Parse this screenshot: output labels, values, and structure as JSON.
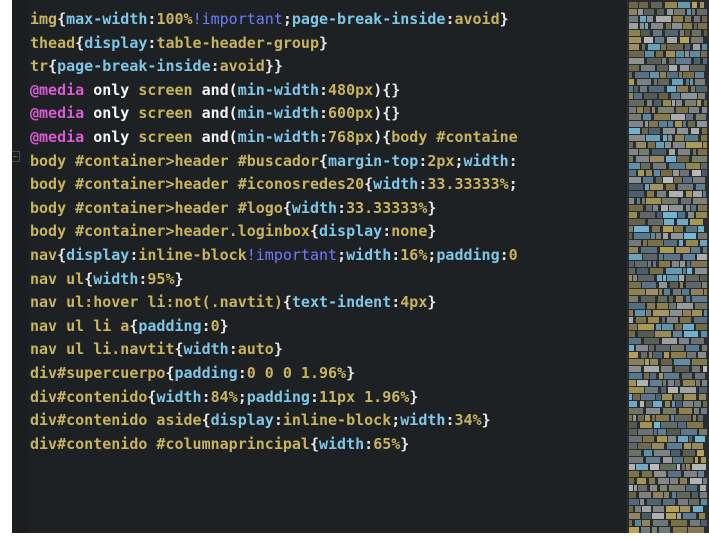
{
  "editor": {
    "fold_glyph": "−",
    "lines": [
      [
        {
          "t": "img",
          "c": "sel"
        },
        {
          "t": "{",
          "c": "punc"
        },
        {
          "t": "max-width",
          "c": "prop"
        },
        {
          "t": ":",
          "c": "punc"
        },
        {
          "t": "100%",
          "c": "val"
        },
        {
          "t": "!important",
          "c": "imp"
        },
        {
          "t": ";",
          "c": "punc"
        },
        {
          "t": "page-break-inside",
          "c": "prop"
        },
        {
          "t": ":",
          "c": "punc"
        },
        {
          "t": "avoid",
          "c": "val"
        },
        {
          "t": "}",
          "c": "punc"
        }
      ],
      [
        {
          "t": "thead",
          "c": "sel"
        },
        {
          "t": "{",
          "c": "punc"
        },
        {
          "t": "display",
          "c": "prop"
        },
        {
          "t": ":",
          "c": "punc"
        },
        {
          "t": "table-header-group",
          "c": "val"
        },
        {
          "t": "}",
          "c": "punc"
        }
      ],
      [
        {
          "t": "tr",
          "c": "sel"
        },
        {
          "t": "{",
          "c": "punc"
        },
        {
          "t": "page-break-inside",
          "c": "prop"
        },
        {
          "t": ":",
          "c": "punc"
        },
        {
          "t": "avoid",
          "c": "val"
        },
        {
          "t": "}}",
          "c": "punc"
        }
      ],
      [
        {
          "t": "@media",
          "c": "atrule"
        },
        {
          "t": " only ",
          "c": "kw"
        },
        {
          "t": "screen",
          "c": "val"
        },
        {
          "t": " and(",
          "c": "kw"
        },
        {
          "t": "min-width",
          "c": "prop"
        },
        {
          "t": ":",
          "c": "punc"
        },
        {
          "t": "480px",
          "c": "val"
        },
        {
          "t": "){}",
          "c": "punc"
        }
      ],
      [
        {
          "t": "@media",
          "c": "atrule"
        },
        {
          "t": " only ",
          "c": "kw"
        },
        {
          "t": "screen",
          "c": "val"
        },
        {
          "t": " and(",
          "c": "kw"
        },
        {
          "t": "min-width",
          "c": "prop"
        },
        {
          "t": ":",
          "c": "punc"
        },
        {
          "t": "600px",
          "c": "val"
        },
        {
          "t": "){}",
          "c": "punc"
        }
      ],
      [
        {
          "t": "@media",
          "c": "atrule"
        },
        {
          "t": " only ",
          "c": "kw"
        },
        {
          "t": "screen",
          "c": "val"
        },
        {
          "t": " and(",
          "c": "kw"
        },
        {
          "t": "min-width",
          "c": "prop"
        },
        {
          "t": ":",
          "c": "punc"
        },
        {
          "t": "768px",
          "c": "val"
        },
        {
          "t": "){",
          "c": "punc"
        },
        {
          "t": "body #containe",
          "c": "sel"
        }
      ],
      [
        {
          "t": "body #container>header #buscador",
          "c": "sel"
        },
        {
          "t": "{",
          "c": "punc"
        },
        {
          "t": "margin-top",
          "c": "prop"
        },
        {
          "t": ":",
          "c": "punc"
        },
        {
          "t": "2px",
          "c": "val"
        },
        {
          "t": ";",
          "c": "punc"
        },
        {
          "t": "width",
          "c": "prop"
        },
        {
          "t": ":",
          "c": "punc"
        }
      ],
      [
        {
          "t": "body #container>header #iconosredes20",
          "c": "sel"
        },
        {
          "t": "{",
          "c": "punc"
        },
        {
          "t": "width",
          "c": "prop"
        },
        {
          "t": ":",
          "c": "punc"
        },
        {
          "t": "33.33333%",
          "c": "val"
        },
        {
          "t": ";",
          "c": "punc"
        }
      ],
      [
        {
          "t": "body #container>header #logo",
          "c": "sel"
        },
        {
          "t": "{",
          "c": "punc"
        },
        {
          "t": "width",
          "c": "prop"
        },
        {
          "t": ":",
          "c": "punc"
        },
        {
          "t": "33.33333%",
          "c": "val"
        },
        {
          "t": "}",
          "c": "punc"
        }
      ],
      [
        {
          "t": "body #container>header.loginbox",
          "c": "sel"
        },
        {
          "t": "{",
          "c": "punc"
        },
        {
          "t": "display",
          "c": "prop"
        },
        {
          "t": ":",
          "c": "punc"
        },
        {
          "t": "none",
          "c": "val"
        },
        {
          "t": "}",
          "c": "punc"
        }
      ],
      [
        {
          "t": "nav",
          "c": "sel"
        },
        {
          "t": "{",
          "c": "punc"
        },
        {
          "t": "display",
          "c": "prop"
        },
        {
          "t": ":",
          "c": "punc"
        },
        {
          "t": "inline-block",
          "c": "val"
        },
        {
          "t": "!important",
          "c": "imp"
        },
        {
          "t": ";",
          "c": "punc"
        },
        {
          "t": "width",
          "c": "prop"
        },
        {
          "t": ":",
          "c": "punc"
        },
        {
          "t": "16%",
          "c": "val"
        },
        {
          "t": ";",
          "c": "punc"
        },
        {
          "t": "padding",
          "c": "prop"
        },
        {
          "t": ":",
          "c": "punc"
        },
        {
          "t": "0",
          "c": "val"
        }
      ],
      [
        {
          "t": "nav ul",
          "c": "sel"
        },
        {
          "t": "{",
          "c": "punc"
        },
        {
          "t": "width",
          "c": "prop"
        },
        {
          "t": ":",
          "c": "punc"
        },
        {
          "t": "95%",
          "c": "val"
        },
        {
          "t": "}",
          "c": "punc"
        }
      ],
      [
        {
          "t": "nav ul:hover li:not(.navtit)",
          "c": "sel"
        },
        {
          "t": "{",
          "c": "punc"
        },
        {
          "t": "text-indent",
          "c": "prop"
        },
        {
          "t": ":",
          "c": "punc"
        },
        {
          "t": "4px",
          "c": "val"
        },
        {
          "t": "}",
          "c": "punc"
        }
      ],
      [
        {
          "t": "nav ul li a",
          "c": "sel"
        },
        {
          "t": "{",
          "c": "punc"
        },
        {
          "t": "padding",
          "c": "prop"
        },
        {
          "t": ":",
          "c": "punc"
        },
        {
          "t": "0",
          "c": "val"
        },
        {
          "t": "}",
          "c": "punc"
        }
      ],
      [
        {
          "t": "nav ul li.navtit",
          "c": "sel"
        },
        {
          "t": "{",
          "c": "punc"
        },
        {
          "t": "width",
          "c": "prop"
        },
        {
          "t": ":",
          "c": "punc"
        },
        {
          "t": "auto",
          "c": "val"
        },
        {
          "t": "}",
          "c": "punc"
        }
      ],
      [
        {
          "t": "div#supercuerpo",
          "c": "sel"
        },
        {
          "t": "{",
          "c": "punc"
        },
        {
          "t": "padding",
          "c": "prop"
        },
        {
          "t": ":",
          "c": "punc"
        },
        {
          "t": "0 0 0 1.96%",
          "c": "val"
        },
        {
          "t": "}",
          "c": "punc"
        }
      ],
      [
        {
          "t": "div#contenido",
          "c": "sel"
        },
        {
          "t": "{",
          "c": "punc"
        },
        {
          "t": "width",
          "c": "prop"
        },
        {
          "t": ":",
          "c": "punc"
        },
        {
          "t": "84%",
          "c": "val"
        },
        {
          "t": ";",
          "c": "punc"
        },
        {
          "t": "padding",
          "c": "prop"
        },
        {
          "t": ":",
          "c": "punc"
        },
        {
          "t": "11px 1.96%",
          "c": "val"
        },
        {
          "t": "}",
          "c": "punc"
        }
      ],
      [
        {
          "t": "div#contenido aside",
          "c": "sel"
        },
        {
          "t": "{",
          "c": "punc"
        },
        {
          "t": "display",
          "c": "prop"
        },
        {
          "t": ":",
          "c": "punc"
        },
        {
          "t": "inline-block",
          "c": "val"
        },
        {
          "t": ";",
          "c": "punc"
        },
        {
          "t": "width",
          "c": "prop"
        },
        {
          "t": ":",
          "c": "punc"
        },
        {
          "t": "34%",
          "c": "val"
        },
        {
          "t": "}",
          "c": "punc"
        }
      ],
      [
        {
          "t": "div#contenido #columnaprincipal",
          "c": "sel"
        },
        {
          "t": "{",
          "c": "punc"
        },
        {
          "t": "width",
          "c": "prop"
        },
        {
          "t": ":",
          "c": "punc"
        },
        {
          "t": "65%",
          "c": "val"
        },
        {
          "t": "}",
          "c": "punc"
        }
      ]
    ]
  },
  "colors": {
    "editor_bg": "#1e2124",
    "at_rule": "#d75bd2",
    "selector": "#c8b35f",
    "property": "#7fc7e8",
    "important": "#6c7cff"
  }
}
